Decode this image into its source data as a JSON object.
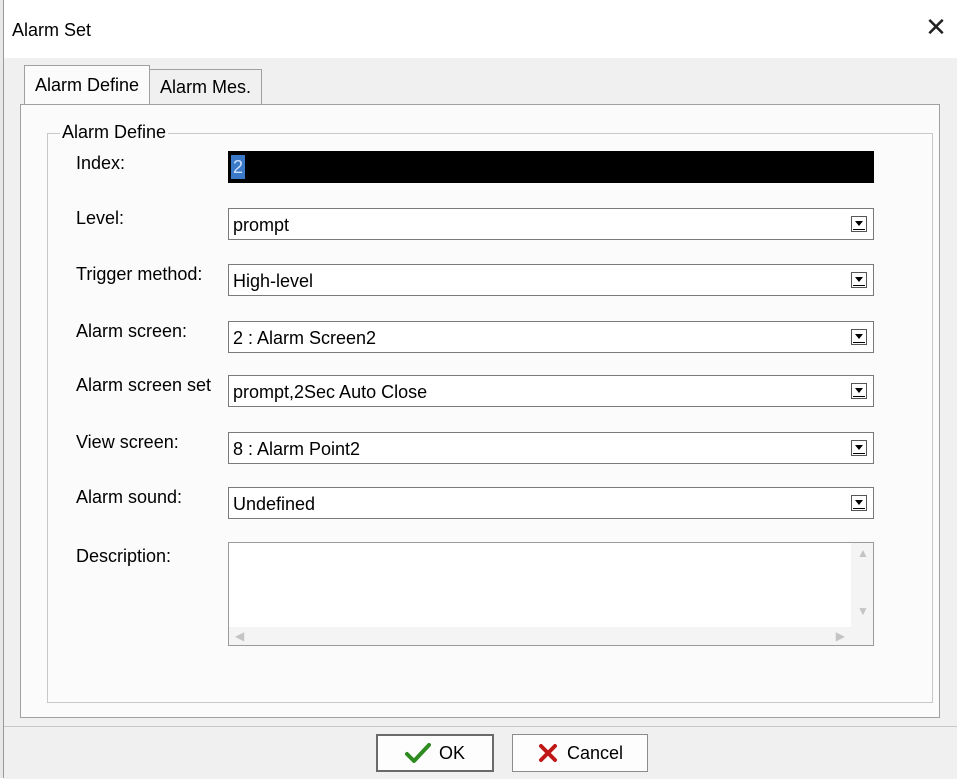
{
  "window": {
    "title": "Alarm Set",
    "close_symbol": "✕"
  },
  "tabs": [
    {
      "label": "Alarm Define",
      "active": true
    },
    {
      "label": "Alarm Mes.",
      "active": false
    }
  ],
  "group": {
    "legend": "Alarm Define",
    "fields": {
      "index": {
        "label": "Index:",
        "value": "2"
      },
      "level": {
        "label": "Level:",
        "value": "prompt"
      },
      "trigger_method": {
        "label": "Trigger method:",
        "value": "High-level"
      },
      "alarm_screen": {
        "label": "Alarm screen:",
        "value": "2 : Alarm Screen2"
      },
      "alarm_screen_set": {
        "label": "Alarm screen set",
        "value": "prompt,2Sec Auto Close"
      },
      "view_screen": {
        "label": "View screen:",
        "value": "8 : Alarm Point2"
      },
      "alarm_sound": {
        "label": "Alarm sound:",
        "value": "Undefined"
      },
      "description": {
        "label": "Description:",
        "value": ""
      }
    }
  },
  "buttons": {
    "ok": {
      "label": "OK",
      "icon": "checkmark-icon",
      "icon_color": "#2e8b1f"
    },
    "cancel": {
      "label": "Cancel",
      "icon": "cross-icon",
      "icon_color": "#c01818"
    }
  }
}
